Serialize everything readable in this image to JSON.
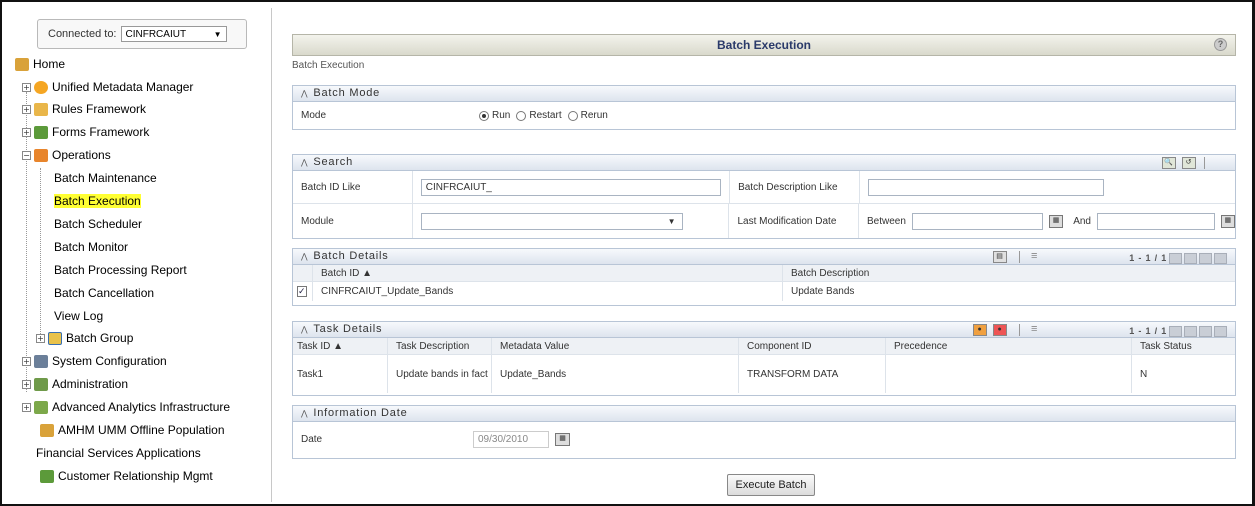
{
  "sidebar": {
    "connected_label": "Connected to:",
    "connected_value": "CINFRCAIUT",
    "items": [
      {
        "label": "Home",
        "icon": "home-icon"
      },
      {
        "label": "Unified Metadata Manager",
        "icon": "metadata-icon"
      },
      {
        "label": "Rules Framework",
        "icon": "rules-icon"
      },
      {
        "label": "Forms Framework",
        "icon": "forms-icon"
      },
      {
        "label": "Operations",
        "icon": "operations-icon"
      },
      {
        "label": "Batch Maintenance"
      },
      {
        "label": "Batch Execution"
      },
      {
        "label": "Batch Scheduler"
      },
      {
        "label": "Batch Monitor"
      },
      {
        "label": "Batch Processing Report"
      },
      {
        "label": "Batch Cancellation"
      },
      {
        "label": "View Log"
      },
      {
        "label": "Batch Group",
        "icon": "batch-group-icon"
      },
      {
        "label": "System Configuration",
        "icon": "system-config-icon"
      },
      {
        "label": "Administration",
        "icon": "administration-icon"
      },
      {
        "label": "Advanced Analytics Infrastructure",
        "icon": "analytics-icon"
      },
      {
        "label": "AMHM UMM Offline Population",
        "icon": "offline-icon"
      },
      {
        "label": "Financial Services Applications"
      },
      {
        "label": "Customer Relationship Mgmt",
        "icon": "crm-icon"
      }
    ]
  },
  "page": {
    "title": "Batch Execution",
    "breadcrumb": "Batch Execution",
    "help": "?"
  },
  "batch_mode": {
    "header": "Batch Mode",
    "label": "Mode",
    "options": [
      "Run",
      "Restart",
      "Rerun"
    ],
    "selected": "Run"
  },
  "search": {
    "header": "Search",
    "batch_id_label": "Batch ID Like",
    "batch_id_value": "CINFRCAIUT_",
    "batch_desc_label": "Batch Description Like",
    "batch_desc_value": "",
    "module_label": "Module",
    "module_value": "",
    "lastmod_label": "Last Modification Date",
    "between_label": "Between",
    "and_label": "And"
  },
  "batch_details": {
    "header": "Batch Details",
    "pager": "1 - 1 / 1",
    "columns": [
      "Batch ID ▲",
      "Batch Description"
    ],
    "rows": [
      {
        "id": "CINFRCAIUT_Update_Bands",
        "desc": "Update Bands"
      }
    ]
  },
  "task_details": {
    "header": "Task Details",
    "pager": "1 - 1 / 1",
    "columns": [
      "Task ID ▲",
      "Task Description",
      "Metadata Value",
      "Component ID",
      "Precedence",
      "Task Status"
    ],
    "rows": [
      {
        "id": "Task1",
        "desc": "Update bands in fact",
        "meta": "Update_Bands",
        "comp": "TRANSFORM DATA",
        "prec": "",
        "status": "N"
      }
    ]
  },
  "info_date": {
    "header": "Information Date",
    "label": "Date",
    "value": "09/30/2010"
  },
  "execute_label": "Execute Batch",
  "colors": {
    "highlight": "#ffff33",
    "title_text": "#2a3a6a",
    "panel_border": "#b8c5d6"
  }
}
